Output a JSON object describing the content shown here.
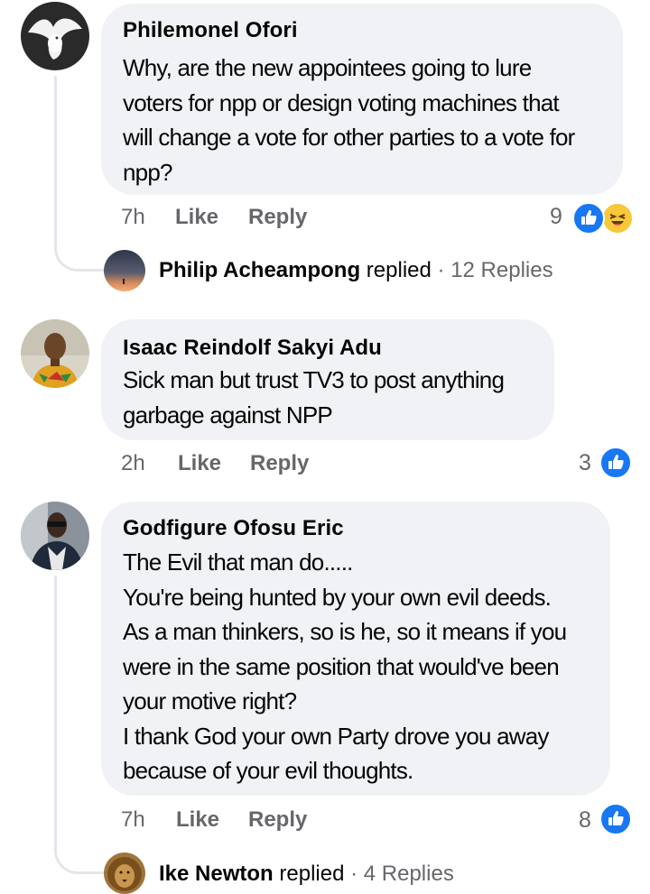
{
  "comments": [
    {
      "author": "Philemonel Ofori",
      "lines": [
        "Why, are the new appointees going to lure",
        "voters for npp or design voting machines that",
        "will change a vote for other parties to a vote for",
        "npp?"
      ],
      "time": "7h",
      "like_label": "Like",
      "reply_label": "Reply",
      "reaction_count": "9",
      "reactions": [
        "like-icon",
        "haha-icon"
      ],
      "replies": {
        "name": "Philip Acheampong",
        "verb": "replied",
        "dot": "·",
        "count": "12 Replies"
      }
    },
    {
      "author": "Isaac Reindolf Sakyi Adu",
      "lines": [
        "Sick man but trust TV3 to post anything",
        "garbage against NPP"
      ],
      "time": "2h",
      "like_label": "Like",
      "reply_label": "Reply",
      "reaction_count": "3",
      "reactions": [
        "like-icon"
      ]
    },
    {
      "author": "Godfigure Ofosu Eric",
      "lines": [
        "The Evil that man do.....",
        "You're being hunted by your own evil deeds.",
        "As a man thinkers, so is he, so it means if you",
        "were in the same position that would've been",
        "your motive right?",
        "I thank God your own Party drove you away",
        "because of your evil thoughts."
      ],
      "time": "7h",
      "like_label": "Like",
      "reply_label": "Reply",
      "reaction_count": "8",
      "reactions": [
        "like-icon"
      ],
      "replies": {
        "name": "Ike Newton",
        "verb": "replied",
        "dot": "·",
        "count": "4 Replies"
      }
    }
  ],
  "colors": {
    "bubble": "#f0f2f5",
    "like_blue": "#1877f2",
    "haha_yellow": "#f7c83a",
    "meta_gray": "#65676b"
  }
}
